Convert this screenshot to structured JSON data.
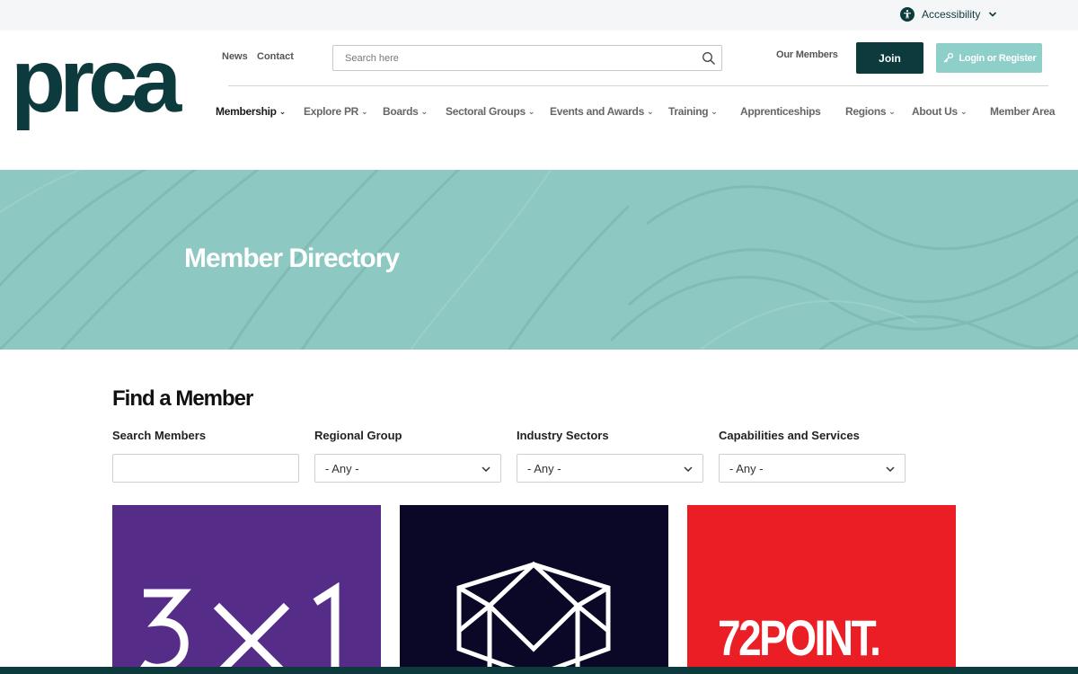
{
  "utility": {
    "accessibility_label": "Accessibility"
  },
  "header": {
    "logo_text": "prca",
    "news_label": "News",
    "contact_label": "Contact",
    "search_placeholder": "Search here",
    "our_members_label": "Our Members",
    "join_label": "Join",
    "login_label": "Login or Register"
  },
  "nav": {
    "items": [
      {
        "label": "Membership",
        "dropdown": true
      },
      {
        "label": "Explore PR",
        "dropdown": true
      },
      {
        "label": "Boards",
        "dropdown": true
      },
      {
        "label": "Sectoral Groups",
        "dropdown": true
      },
      {
        "label": "Events and Awards",
        "dropdown": true
      },
      {
        "label": "Training",
        "dropdown": true
      },
      {
        "label": "Apprenticeships",
        "dropdown": false
      },
      {
        "label": "Regions",
        "dropdown": true
      },
      {
        "label": "About Us",
        "dropdown": true
      },
      {
        "label": "Member Area",
        "dropdown": false
      }
    ],
    "caret": "⌄"
  },
  "hero": {
    "title": "Member Directory"
  },
  "find": {
    "title": "Find a Member",
    "filters": {
      "search_members": {
        "label": "Search Members",
        "value": ""
      },
      "regional_group": {
        "label": "Regional Group",
        "value": "- Any -"
      },
      "industry_sectors": {
        "label": "Industry Sectors",
        "value": "- Any -"
      },
      "capabilities": {
        "label": "Capabilities and Services",
        "value": "- Any -"
      }
    }
  },
  "members": [
    {
      "logo_text": "3×1",
      "color": "#552c88"
    },
    {
      "logo_text": "",
      "color": "#0a0727"
    },
    {
      "logo_text": "72POINT.",
      "color": "#eb1d25"
    }
  ],
  "colors": {
    "brand_dark": "#0c3a3d",
    "brand_teal": "#8ecfca",
    "hero_bg": "#8ec8c3"
  }
}
